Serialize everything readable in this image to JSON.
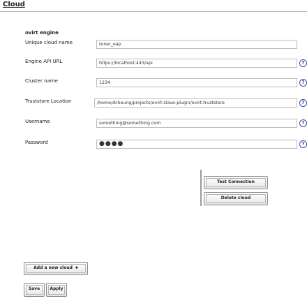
{
  "section": {
    "title": "Cloud"
  },
  "engine": {
    "header": "ovirt engine"
  },
  "fields": [
    {
      "key": "cloud_name",
      "label": "Unique cloud name",
      "value": "toner_eap",
      "help": false
    },
    {
      "key": "api_url",
      "label": "Engine API URL",
      "value": "https://localhost:443/api",
      "help": true
    },
    {
      "key": "cluster",
      "label": "Cluster name",
      "value": "1234",
      "help": true
    },
    {
      "key": "truststore",
      "label": "Truststore Location",
      "value": "/home/dcheung/projects/ovirt-slave-plugin/ovirt.truststore",
      "help": true
    },
    {
      "key": "username",
      "label": "Username",
      "value": "something@something.com",
      "help": true
    },
    {
      "key": "password",
      "label": "Password",
      "value": "●●●●",
      "help": true
    }
  ],
  "help_icon": {
    "glyph": "?",
    "icon": "help-circle-icon",
    "color": "#3a4da0"
  },
  "buttons": {
    "test_connection": "Test Connection",
    "delete_cloud": "Delete cloud",
    "add_cloud": "Add a new cloud",
    "add_cloud_caret": "▼",
    "save": "Save",
    "apply": "Apply"
  }
}
